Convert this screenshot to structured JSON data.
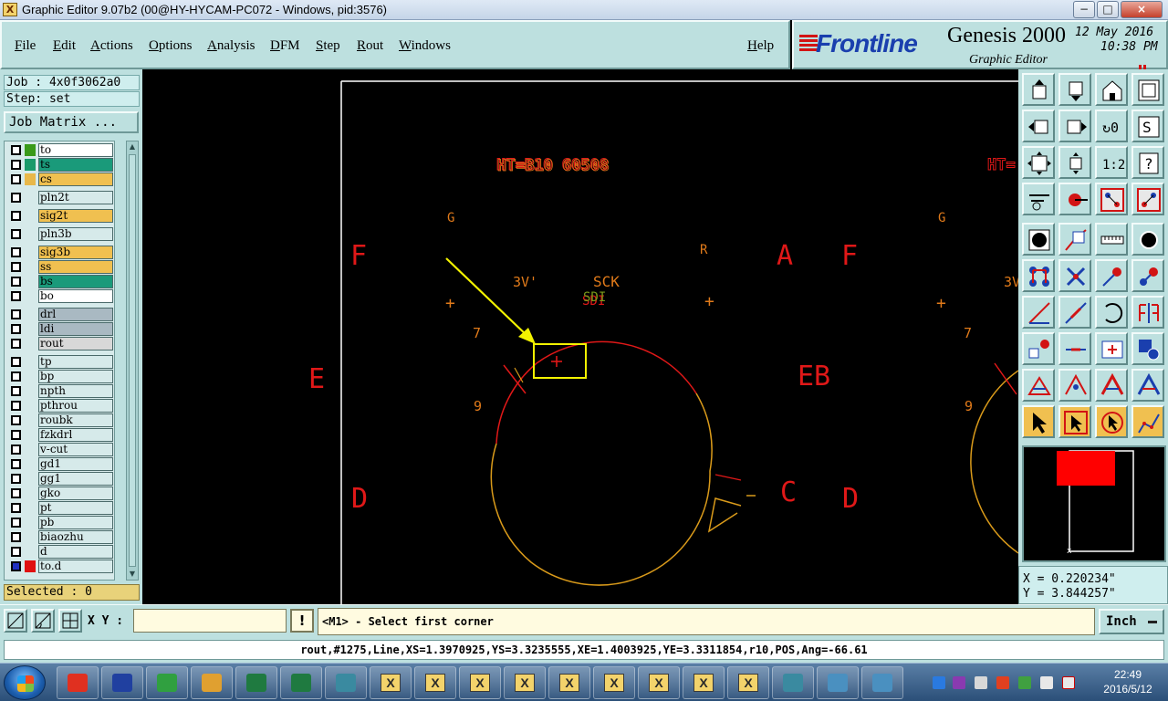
{
  "window": {
    "title": "Graphic Editor 9.07b2 (00@HY-HYCAM-PC072 - Windows, pid:3576)",
    "min_glyph": "−",
    "max_glyph": "□",
    "close_glyph": "×"
  },
  "menu": {
    "file": "File",
    "edit": "Edit",
    "actions": "Actions",
    "options": "Options",
    "analysis": "Analysis",
    "dfm": "DFM",
    "step": "Step",
    "rout": "Rout",
    "windows": "Windows",
    "help": "Help"
  },
  "brand": {
    "logo": "Frontline",
    "product": "Genesis 2000",
    "subtitle": "Graphic Editor",
    "date": "12 May 2016",
    "time": "10:38 PM",
    "accent": "#d21414",
    "logo_color": "#1a3fae"
  },
  "left_panel": {
    "job": "Job : 4x0f3062a0",
    "step": "Step: set",
    "job_matrix": "Job Matrix ...",
    "selected": "Selected : 0",
    "layers": [
      {
        "name": "to",
        "swatch": "#3a9a1a",
        "bg": "#ffffff"
      },
      {
        "name": "ts",
        "swatch": "#1a9a6a",
        "bg": "#1a9a7a"
      },
      {
        "name": "cs",
        "swatch": "#e8b84a",
        "bg": "#f0c050"
      },
      {
        "name": "pln2t",
        "swatch": "",
        "bg": "#d6eaea"
      },
      {
        "name": "sig2t",
        "swatch": "",
        "bg": "#f0c050"
      },
      {
        "name": "pln3b",
        "swatch": "",
        "bg": "#d6eaea"
      },
      {
        "name": "sig3b",
        "swatch": "",
        "bg": "#f0c050"
      },
      {
        "name": "ss",
        "swatch": "",
        "bg": "#f0c050"
      },
      {
        "name": "bs",
        "swatch": "",
        "bg": "#1a9a7a"
      },
      {
        "name": "bo",
        "swatch": "",
        "bg": "#ffffff"
      },
      {
        "name": "drl",
        "swatch": "",
        "bg": "#a9b9c2"
      },
      {
        "name": "ldi",
        "swatch": "",
        "bg": "#a9b9c2"
      },
      {
        "name": "rout",
        "swatch": "",
        "bg": "#d8d8d8"
      },
      {
        "name": "tp",
        "swatch": "",
        "bg": "#d6eaea"
      },
      {
        "name": "bp",
        "swatch": "",
        "bg": "#d6eaea"
      },
      {
        "name": "npth",
        "swatch": "",
        "bg": "#d6eaea"
      },
      {
        "name": "pthrou",
        "swatch": "",
        "bg": "#d6eaea"
      },
      {
        "name": "roubk",
        "swatch": "",
        "bg": "#d6eaea"
      },
      {
        "name": "fzkdrl",
        "swatch": "",
        "bg": "#d6eaea"
      },
      {
        "name": "v-cut",
        "swatch": "",
        "bg": "#d6eaea"
      },
      {
        "name": "gd1",
        "swatch": "",
        "bg": "#d6eaea"
      },
      {
        "name": "gg1",
        "swatch": "",
        "bg": "#d6eaea"
      },
      {
        "name": "gko",
        "swatch": "",
        "bg": "#d6eaea"
      },
      {
        "name": "pt",
        "swatch": "",
        "bg": "#d6eaea"
      },
      {
        "name": "pb",
        "swatch": "",
        "bg": "#d6eaea"
      },
      {
        "name": "biaozhu",
        "swatch": "",
        "bg": "#d6eaea"
      },
      {
        "name": "d",
        "swatch": "",
        "bg": "#d6eaea"
      },
      {
        "name": "to.d",
        "swatch": "#e01010",
        "bg": "#d6eaea"
      }
    ]
  },
  "canvas": {
    "labels": {
      "header_left": "HT=B10  60508",
      "header_right": "HT=",
      "g_left": "G",
      "g_right": "G",
      "r": "R",
      "f_left": "F",
      "a": "A",
      "f_right": "F",
      "e_left": "E",
      "e_right": "EB",
      "d_left": "D",
      "c": "C",
      "d_right": "D",
      "three_v": "3V'",
      "three_v_right": "3V",
      "sck": "SCK",
      "sdi": "SDI",
      "seven_left": "7",
      "seven_right": "7",
      "nine_left": "9",
      "nine_right": "9",
      "cross": "+"
    },
    "colors": {
      "red": "#e01818",
      "orange": "#e07a1a",
      "gold": "#d99a1a",
      "yellow": "#f3f300",
      "white": "#ffffff"
    }
  },
  "toolbar_right": {
    "icons": [
      "zoom-home-icon",
      "zoom-back-icon",
      "home-icon",
      "zoom-window-icon",
      "pan-left-icon",
      "pan-right-icon",
      "zoom-fit-icon",
      "snap-icon",
      "zoom-extents-icon",
      "zoom-center-icon",
      "scale-1-2-icon",
      "help-icon",
      "measure-tool-icon",
      "drill-icon",
      "layer-align-icon",
      "layer-align2-icon",
      "fill-icon",
      "outline-icon",
      "ruler-icon",
      "pad-icon",
      "connect-icon",
      "cross-select-icon",
      "arc-point-icon",
      "arc-point2-icon",
      "line-icon",
      "angle-line-icon",
      "arc-icon",
      "flip-icon",
      "break-icon",
      "extend-icon",
      "shift-icon",
      "copy-icon",
      "triangle-icon",
      "tri-peak-icon",
      "tri-red-icon",
      "tri-blue-icon",
      "select-arrow-icon",
      "select-box-icon",
      "select-poly-icon",
      "select-path-icon"
    ]
  },
  "coords": {
    "x": "X = 0.220234\"",
    "y": "Y = 3.844257\""
  },
  "command": {
    "xy_label": "X Y :",
    "xy_value": "",
    "warn": "!",
    "prompt": "<M1> - Select first corner",
    "unit": "Inch"
  },
  "status": {
    "text": "rout,#1275,Line,XS=1.3970925,YS=3.3235555,XE=1.4003925,YE=3.3311854,r10,POS,Ang=-66.61"
  },
  "taskbar": {
    "time": "22:49",
    "date": "2016/5/12",
    "tasks": [
      "genesis-g-icon",
      "save-icon",
      "frontline-f-icon",
      "shell-icon",
      "excel-icon",
      "excel2-icon",
      "disk-icon",
      "x1",
      "x2",
      "x3",
      "x4",
      "x5",
      "x6",
      "x7",
      "x8",
      "x9",
      "eye-icon",
      "image-icon",
      "image2-icon"
    ],
    "x_label": "X"
  }
}
